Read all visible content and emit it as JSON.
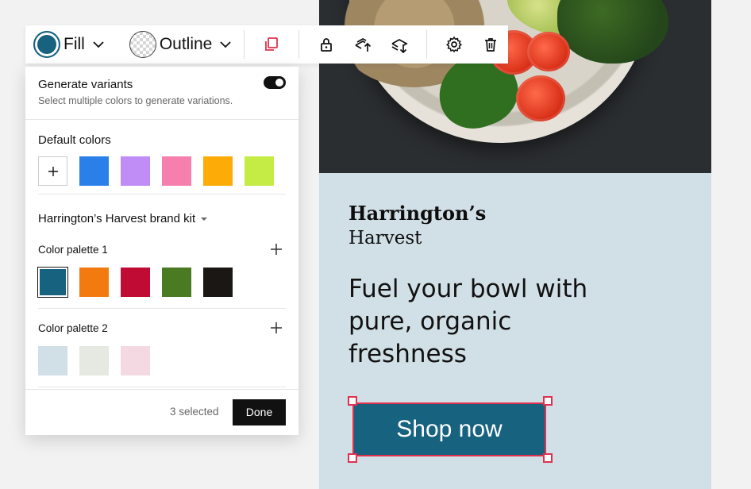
{
  "toolbar": {
    "fill_label": "Fill",
    "outline_label": "Outline",
    "fill_color": "#16627f"
  },
  "panel": {
    "generate_title": "Generate variants",
    "generate_subtitle": "Select multiple colors to generate variations.",
    "generate_enabled": true,
    "default_title": "Default colors",
    "default_colors": [
      "#2b7fe8",
      "#c08cf5",
      "#f77fae",
      "#fdab07",
      "#c4ec45"
    ],
    "brand_kit_title": "Harrington’s Harvest brand kit",
    "palette1_title": "Color palette 1",
    "palette1_colors": [
      "#16627f",
      "#f37a0f",
      "#c00b34",
      "#4a7a22",
      "#1a1714"
    ],
    "palette2_title": "Color palette 2",
    "palette2_colors": [
      "#d1dfe6",
      "#e6e9e2",
      "#f4d9e2"
    ],
    "selected_count": "3 selected",
    "done_label": "Done"
  },
  "canvas": {
    "brand_line1": "Harrington’s",
    "brand_line2": "Harvest",
    "headline": "Fuel your bowl with pure, organic freshness",
    "cta_label": "Shop now",
    "background": "#d1dfe6",
    "accent": "#e0324f"
  }
}
